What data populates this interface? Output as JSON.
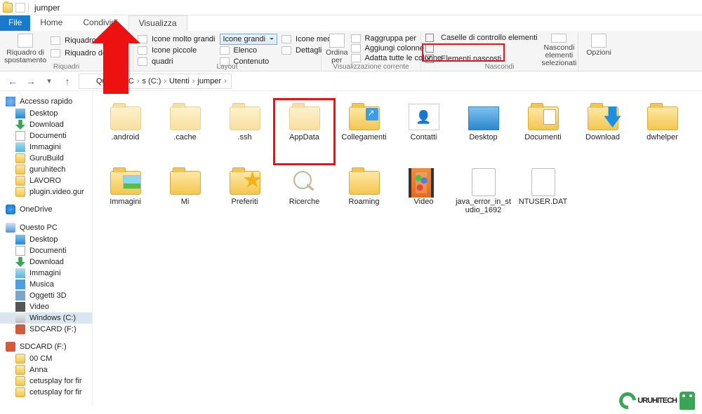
{
  "window": {
    "title": "jumper"
  },
  "tabs": {
    "file": "File",
    "home": "Home",
    "share": "Condividi",
    "view": "Visualizza"
  },
  "ribbon": {
    "panes": {
      "pane_btn": "Riquadro di\nspostamento",
      "preview": "Riquadro di anteprim",
      "details": "Riquadro dettagli",
      "group": "Riquadri"
    },
    "layout": {
      "xl": "Icone molto grandi",
      "l": "Icone grandi",
      "m": "Icone medie",
      "s": "Icone piccole",
      "list": "Elenco",
      "det": "Dettagli",
      "tiles": "quadri",
      "content": "Contenuto",
      "group": "Layout"
    },
    "sort": {
      "btn": "Ordina\nper",
      "group_by": "Raggruppa per",
      "add_col": "Aggiungi colonne",
      "fit_col": "Adatta tutte le colonne",
      "group": "Visualizzazione corrente"
    },
    "showhide": {
      "checkboxes": "Caselle di controllo elementi",
      "ext": "",
      "hidden": "Elementi nascosti",
      "hide_btn": "Nascondi elementi\nselezionati",
      "group": "Nascondi"
    },
    "options": "Opzioni"
  },
  "breadcrumb": [
    "Questo PC",
    "s (C:)",
    "Utenti",
    "jumper"
  ],
  "tree": {
    "quick": {
      "head": "Accesso rapido",
      "items": [
        "Desktop",
        "Download",
        "Documenti",
        "Immagini",
        "GuruBuild",
        "guruhitech",
        "LAVORO",
        "plugin.video.gur"
      ]
    },
    "onedrive": "OneDrive",
    "thispc": {
      "head": "Questo PC",
      "items": [
        "Desktop",
        "Documenti",
        "Download",
        "Immagini",
        "Musica",
        "Oggetti 3D",
        "Video",
        "Windows (C:)",
        "SDCARD (F:)"
      ]
    },
    "sdcard": {
      "head": "SDCARD (F:)",
      "items": [
        "00 CM",
        "Anna",
        "cetusplay for fir",
        "cetusplay for fir"
      ]
    }
  },
  "files": [
    {
      "name": ".android",
      "type": "folder-faded"
    },
    {
      "name": ".cache",
      "type": "folder-faded"
    },
    {
      "name": ".ssh",
      "type": "folder-faded"
    },
    {
      "name": "AppData",
      "type": "folder-faded",
      "highlight": true
    },
    {
      "name": "Collegamenti",
      "type": "folder-link"
    },
    {
      "name": "Contatti",
      "type": "contact"
    },
    {
      "name": "Desktop",
      "type": "desktop"
    },
    {
      "name": "Documenti",
      "type": "folder-doc"
    },
    {
      "name": "Download",
      "type": "folder-dl"
    },
    {
      "name": "dwhelper",
      "type": "folder"
    },
    {
      "name": "Immagini",
      "type": "folder-img"
    },
    {
      "name": "Mi",
      "type": "folder",
      "cut": true
    },
    {
      "name": "Preferiti",
      "type": "folder-star"
    },
    {
      "name": "Ricerche",
      "type": "search"
    },
    {
      "name": "Roaming",
      "type": "folder"
    },
    {
      "name": "Video",
      "type": "video"
    },
    {
      "name": "java_error_in_studio_1692",
      "type": "doc"
    },
    {
      "name": "NTUSER.DAT",
      "type": "doc"
    }
  ],
  "watermark": "URUHITECH"
}
